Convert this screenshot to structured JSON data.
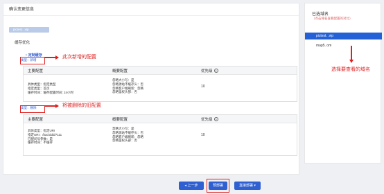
{
  "main": {
    "title": "确认变更信息",
    "domain_tag": "pictest.      .vip",
    "section": "缓存优化",
    "custom_label": "定制缓存",
    "new_type": "类型：新增",
    "del_type": "类型：删除"
  },
  "table1": {
    "headers": [
      "主要配置",
      "概要配置",
      "优先级"
    ],
    "col1": [
      "具体类型：指定类型",
      "指定类型：首页",
      "缓存时间：缓存配置时间: 24小时"
    ],
    "col2": [
      "忽略大小写：是",
      "忽略源站不缓存头：否",
      "忽略客户端刷新：忽略",
      "忽略鉴权头部：否"
    ],
    "priority": "10"
  },
  "table2": {
    "headers": [
      "主要配置",
      "概要配置",
      "优先级"
    ],
    "col1": [
      "具体类型：指定URI",
      "指定URI：/bac/ddd/7111",
      "已配问号参数：是",
      "缓存时间：不缓存"
    ],
    "col2": [
      "忽略大小写：是",
      "忽略源站不缓存头：否",
      "忽略客户端刷新：忽略",
      "忽略鉴权头部：否"
    ],
    "priority": "10"
  },
  "annotations": {
    "new_config": "此次新增的配置",
    "old_config": "将被删除的旧配置",
    "select_domain": "选择要查看的域名"
  },
  "side": {
    "title": "已选域名",
    "hint": "（点击域名查看配置的对比）",
    "items": [
      "pictest.      .vip",
      "map5.       om"
    ]
  },
  "buttons": {
    "prev": "◂ 上一步",
    "deploy": "预部署",
    "direct": "直接部署 ▾"
  },
  "colors": {
    "accent": "#2f5fd0",
    "annotation": "#e02020",
    "active_item": "#2561d6"
  }
}
